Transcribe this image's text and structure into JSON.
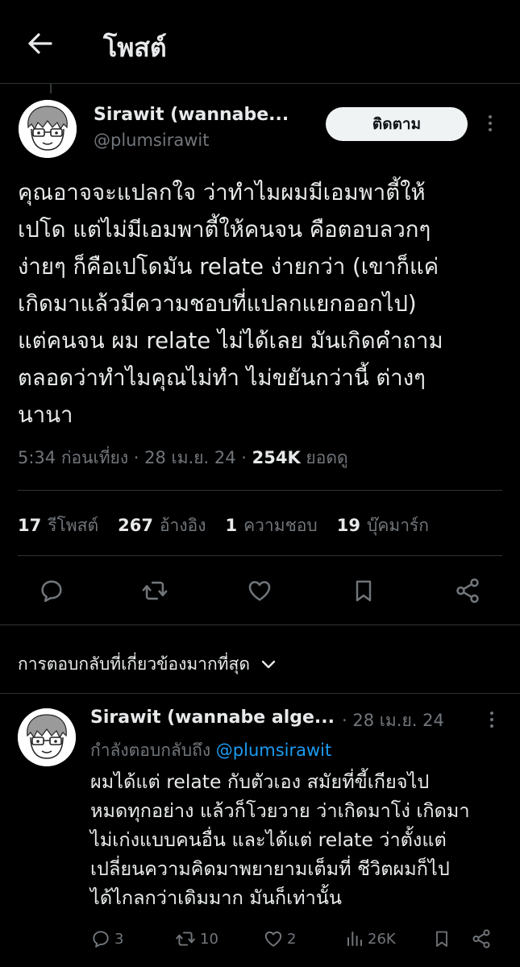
{
  "header": {
    "title": "โพสต์"
  },
  "post": {
    "author_name": "Sirawit (wannabe...",
    "author_handle": "@plumsirawit",
    "follow_label": "ติดตาม",
    "text": "คุณอาจจะแปลกใจ ว่าทำไมผมมีเอมพาตี้ให้\nเปโด แต่ไม่มีเอมพาตี้ให้คนจน คือตอบลวกๆ\nง่ายๆ ก็คือเปโดมัน relate ง่ายกว่า (เขาก็แค่\nเกิดมาแล้วมีความชอบที่แปลกแยกออกไป)\nแต่คนจน ผม relate ไม่ได้เลย มันเกิดคำถาม\nตลอดว่าทำไมคุณไม่ทำ ไม่ขยันกว่านี้ ต่างๆ\nนานา",
    "timestamp": "5:34 ก่อนเที่ยง · 28 เม.ย. 24 · ",
    "views_count": "254K",
    "views_label": " ยอดดู",
    "stats": [
      {
        "num": "17",
        "label": "รีโพสต์"
      },
      {
        "num": "267",
        "label": "อ้างอิง"
      },
      {
        "num": "1",
        "label": "ความชอบ"
      },
      {
        "num": "19",
        "label": "บุ๊คมาร์ก"
      }
    ]
  },
  "replies_sort": {
    "label": "การตอบกลับที่เกี่ยวข้องมากที่สุด"
  },
  "reply": {
    "author_name": "Sirawit (wannabe alge...",
    "date": "· 28 เม.ย. 24",
    "replying_prefix": "กำลังตอบกลับถึง ",
    "replying_mention": "@plumsirawit",
    "text": "ผมได้แต่ relate กับตัวเอง สมัยที่ขี้เกียจไป\nหมดทุกอย่าง แล้วก็โวยวาย ว่าเกิดมาโง่ เกิดมา\nไม่เก่งแบบคนอื่น และได้แต่ relate ว่าตั้งแต่\nเปลี่ยนความคิดมาพยายามเต็มที่ ชีวิตผมก็ไป\nได้ไกลกว่าเดิมมาก มันก็เท่านั้น",
    "actions": {
      "replies": "3",
      "reposts": "10",
      "likes": "2",
      "views": "26K"
    }
  },
  "icons": {
    "back": "arrow-left-icon",
    "reply": "reply-icon",
    "repost": "repost-icon",
    "like": "heart-icon",
    "bookmark": "bookmark-icon",
    "share": "share-icon",
    "views": "analytics-icon",
    "chevron": "chevron-down-icon"
  },
  "colors": {
    "background": "#000000",
    "text": "#e7e9ea",
    "secondary": "#71767b",
    "link": "#1d9bf0",
    "follow_button_bg": "#eff3f4"
  }
}
